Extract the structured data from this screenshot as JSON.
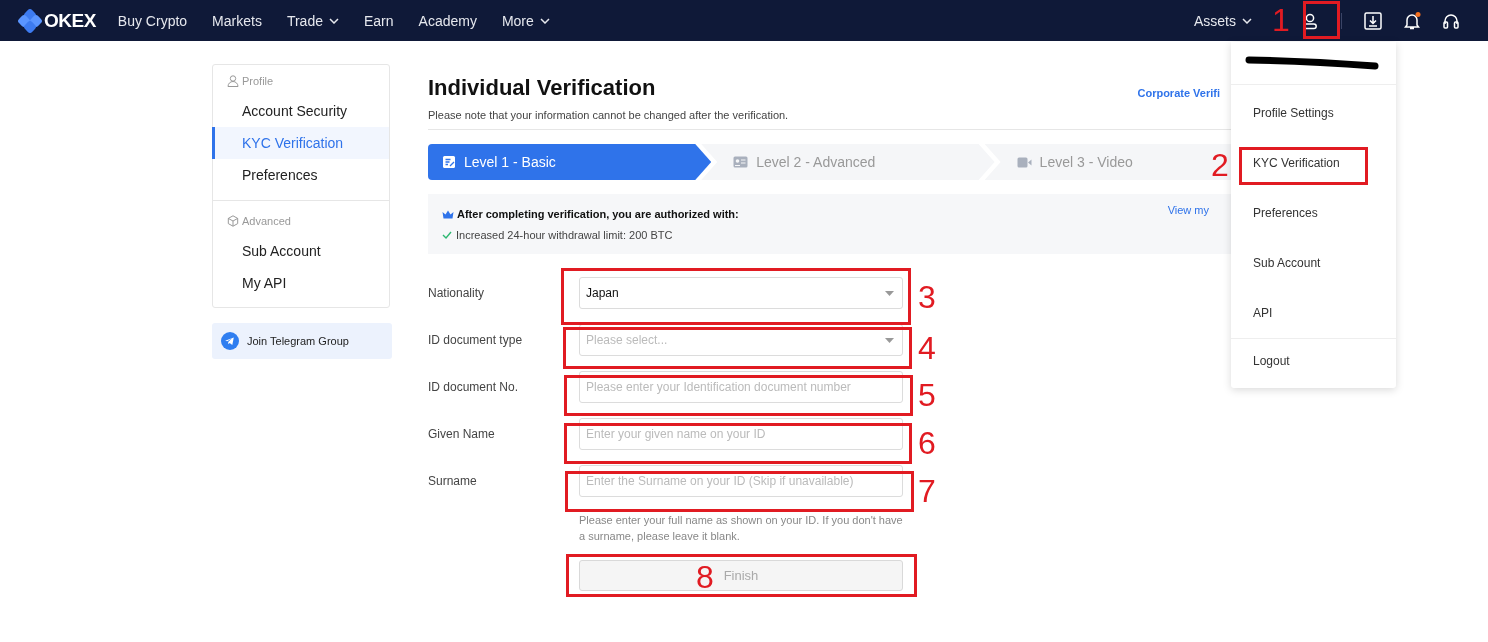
{
  "nav": {
    "logo": "OKEX",
    "items": [
      {
        "label": "Buy Crypto",
        "has_menu": false
      },
      {
        "label": "Markets",
        "has_menu": false
      },
      {
        "label": "Trade",
        "has_menu": true
      },
      {
        "label": "Earn",
        "has_menu": false
      },
      {
        "label": "Academy",
        "has_menu": false
      },
      {
        "label": "More",
        "has_menu": true
      }
    ],
    "assets": "Assets",
    "bell_unread": true
  },
  "sidebar": {
    "sections": [
      {
        "title": "Profile",
        "kind": "profile",
        "items": [
          {
            "label": "Account Security",
            "selected": false
          },
          {
            "label": "KYC Verification",
            "selected": true
          },
          {
            "label": "Preferences",
            "selected": false
          }
        ]
      },
      {
        "title": "Advanced",
        "kind": "advanced",
        "items": [
          {
            "label": "Sub Account",
            "selected": false
          },
          {
            "label": "My API",
            "selected": false
          }
        ]
      }
    ],
    "telegram": "Join Telegram Group"
  },
  "page": {
    "title": "Individual Verification",
    "note": "Please note that your information cannot be changed after the verification.",
    "corporate_link": "Corporate Verifi"
  },
  "steps": [
    {
      "label": "Level 1 - Basic",
      "kind": "basic",
      "selected": true
    },
    {
      "label": "Level 2 - Advanced",
      "kind": "advanced",
      "selected": false
    },
    {
      "label": "Level 3 - Video",
      "kind": "video",
      "selected": false
    }
  ],
  "benefits": {
    "heading": "After completing verification, you are authorized with:",
    "items": [
      "Increased 24-hour withdrawal limit: 200 BTC"
    ],
    "link": "View my"
  },
  "form": {
    "fields": [
      {
        "label": "Nationality",
        "kind": "select",
        "value": "Japan"
      },
      {
        "label": "ID document type",
        "kind": "select",
        "placeholder": "Please select..."
      },
      {
        "label": "ID document No.",
        "kind": "text",
        "placeholder": "Please enter your Identification document number"
      },
      {
        "label": "Given Name",
        "kind": "text",
        "placeholder": "Enter your given name on your ID"
      },
      {
        "label": "Surname",
        "kind": "text",
        "placeholder": "Enter the Surname on your ID (Skip if unavailable)"
      }
    ],
    "hint": "Please enter your full name as shown on your ID. If you don't have a surname, please leave it blank.",
    "submit": {
      "label": "Finish",
      "disabled": true
    }
  },
  "account_menu": {
    "items": [
      {
        "label": "Profile Settings",
        "divider_before": false
      },
      {
        "label": "KYC Verification",
        "divider_before": false
      },
      {
        "label": "Preferences",
        "divider_before": false
      },
      {
        "label": "Sub Account",
        "divider_before": false
      },
      {
        "label": "API",
        "divider_before": false
      },
      {
        "label": "Logout",
        "divider_before": true
      }
    ]
  },
  "annotations": [
    {
      "number": "1"
    },
    {
      "number": "2"
    },
    {
      "number": "3"
    },
    {
      "number": "4"
    },
    {
      "number": "5"
    },
    {
      "number": "6"
    },
    {
      "number": "7"
    },
    {
      "number": "8"
    }
  ]
}
